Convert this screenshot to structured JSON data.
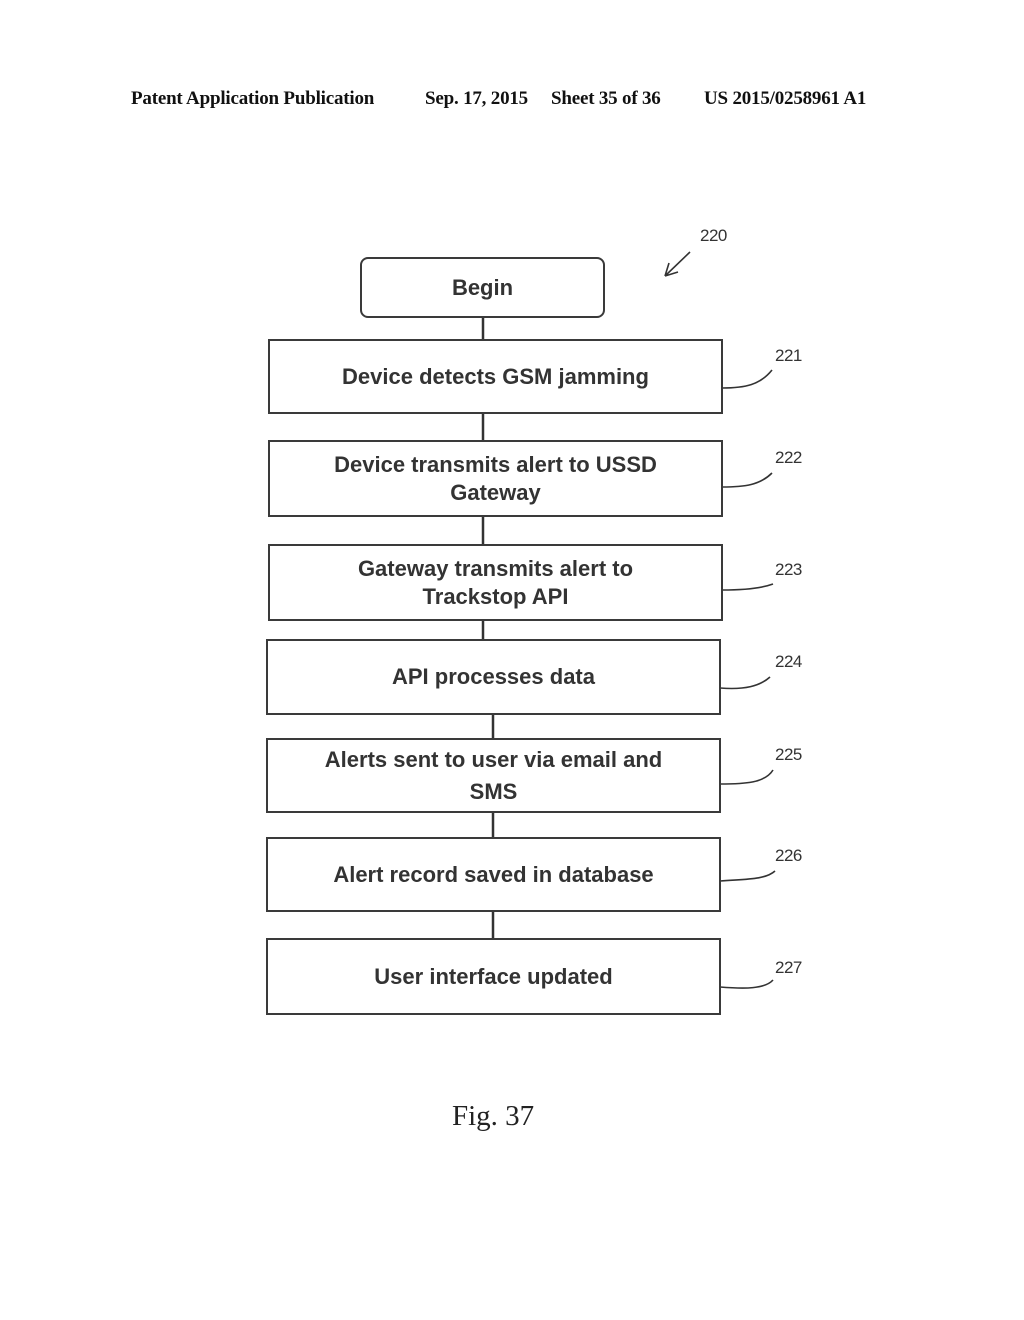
{
  "header": {
    "publication": "Patent Application Publication",
    "date": "Sep. 17, 2015",
    "sheet": "Sheet 35 of 36",
    "number": "US 2015/0258961 A1"
  },
  "diagram": {
    "figure_ref": "220",
    "start": "Begin",
    "steps": [
      {
        "ref": "221",
        "lines": [
          "Device detects GSM jamming"
        ]
      },
      {
        "ref": "222",
        "lines": [
          "Device transmits alert to USSD",
          "Gateway"
        ]
      },
      {
        "ref": "223",
        "lines": [
          "Gateway transmits alert to",
          "Trackstop API"
        ]
      },
      {
        "ref": "224",
        "lines": [
          "API processes data"
        ]
      },
      {
        "ref": "225",
        "lines": [
          "Alerts sent to user via email and",
          "SMS"
        ]
      },
      {
        "ref": "226",
        "lines": [
          "Alert record saved in database"
        ]
      },
      {
        "ref": "227",
        "lines": [
          "User interface updated"
        ]
      }
    ]
  },
  "caption": "Fig. 37"
}
